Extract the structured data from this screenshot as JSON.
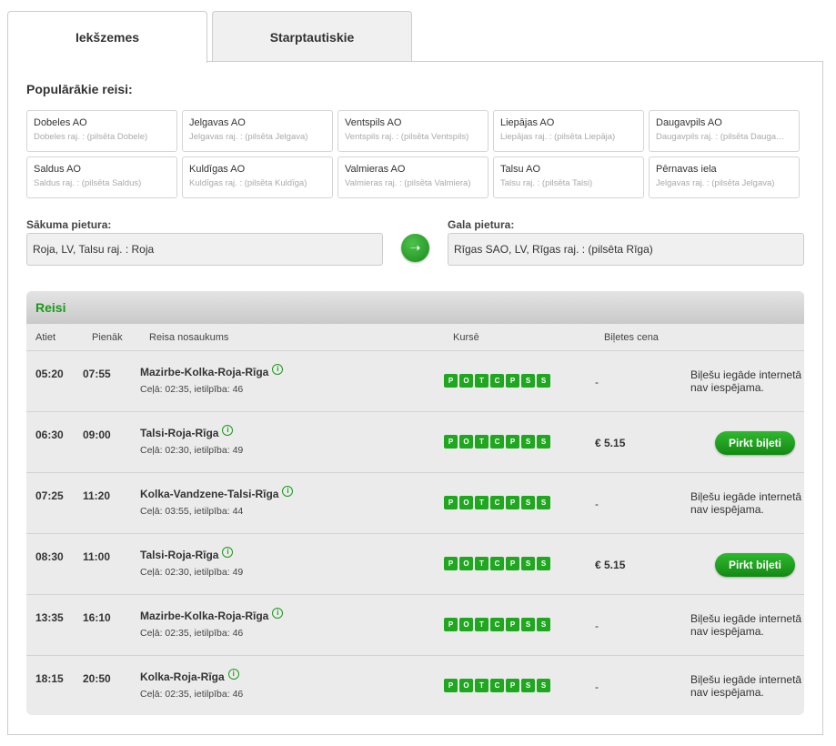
{
  "tabs": [
    {
      "label": "Iekšzemes"
    },
    {
      "label": "Starptautiskie"
    }
  ],
  "popular": {
    "title": "Populārākie reisi:",
    "items": [
      {
        "name": "Dobeles AO",
        "sub": "Dobeles raj. : (pilsēta Dobele)"
      },
      {
        "name": "Jelgavas AO",
        "sub": "Jelgavas raj. : (pilsēta Jelgava)"
      },
      {
        "name": "Ventspils AO",
        "sub": "Ventspils raj. : (pilsēta Ventspils)"
      },
      {
        "name": "Liepājas AO",
        "sub": "Liepājas raj. : (pilsēta Liepāja)"
      },
      {
        "name": "Daugavpils AO",
        "sub": "Daugavpils raj. : (pilsēta Dauga…"
      },
      {
        "name": "Saldus AO",
        "sub": "Saldus raj. : (pilsēta Saldus)"
      },
      {
        "name": "Kuldīgas AO",
        "sub": "Kuldīgas raj. : (pilsēta Kuldīga)"
      },
      {
        "name": "Valmieras AO",
        "sub": "Valmieras raj. : (pilsēta Valmiera)"
      },
      {
        "name": "Talsu AO",
        "sub": "Talsu raj. : (pilsēta Talsi)"
      },
      {
        "name": "Pērnavas iela",
        "sub": "Jelgavas raj. : (pilsēta Jelgava)"
      }
    ]
  },
  "search": {
    "from_label": "Sākuma pietura:",
    "from_value": "Roja, LV, Talsu raj. : Roja",
    "to_label": "Gala pietura:",
    "to_value": "Rīgas SAO, LV, Rīgas raj. : (pilsēta Rīga)",
    "swap_glyph": "➝"
  },
  "results": {
    "title": "Reisi",
    "columns": {
      "dep": "Atiet",
      "arr": "Pienāk",
      "name": "Reisa nosaukums",
      "days": "Kursē",
      "price": "Biļetes cena"
    },
    "day_letters": [
      "P",
      "O",
      "T",
      "C",
      "P",
      "S",
      "S"
    ],
    "no_online_text": "Biļešu iegāde internetā nav iespējama.",
    "buy_label": "Pirkt biļeti",
    "info_glyph": "i",
    "rows": [
      {
        "dep": "05:20",
        "arr": "07:55",
        "name": "Mazirbe-Kolka-Roja-Rīga",
        "sub": "Ceļā: 02:35, ietilpība: 46",
        "price": "-",
        "buy": false
      },
      {
        "dep": "06:30",
        "arr": "09:00",
        "name": "Talsi-Roja-Rīga",
        "sub": "Ceļā: 02:30, ietilpība: 49",
        "price": "€ 5.15",
        "buy": true
      },
      {
        "dep": "07:25",
        "arr": "11:20",
        "name": "Kolka-Vandzene-Talsi-Rīga",
        "sub": "Ceļā: 03:55, ietilpība: 44",
        "price": "-",
        "buy": false
      },
      {
        "dep": "08:30",
        "arr": "11:00",
        "name": "Talsi-Roja-Rīga",
        "sub": "Ceļā: 02:30, ietilpība: 49",
        "price": "€ 5.15",
        "buy": true
      },
      {
        "dep": "13:35",
        "arr": "16:10",
        "name": "Mazirbe-Kolka-Roja-Rīga",
        "sub": "Ceļā: 02:35, ietilpība: 46",
        "price": "-",
        "buy": false
      },
      {
        "dep": "18:15",
        "arr": "20:50",
        "name": "Kolka-Roja-Rīga",
        "sub": "Ceļā: 02:35, ietilpība: 46",
        "price": "-",
        "buy": false
      }
    ]
  },
  "colors": {
    "accent": "#1fa81f",
    "title_green": "#1a9a1a"
  }
}
